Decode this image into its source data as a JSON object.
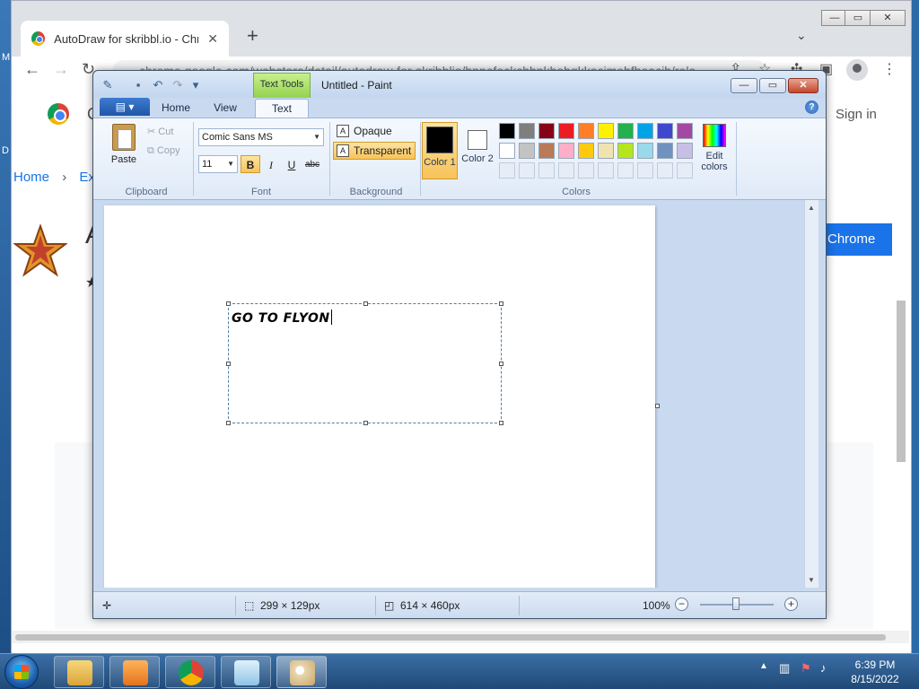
{
  "browser": {
    "tab_title": "AutoDraw for skribbl.io - Chrome Web Store",
    "url": "chrome.google.com/webstore/detail/autodraw-for-skribblio/bnpefeckchbnkbabgkkacimehfheacib/rela...",
    "signin_label": "Sign in",
    "breadcrumb_home": "Home",
    "breadcrumb_sep": "›",
    "breadcrumb_next": "Ext",
    "add_button_label": "Chrome",
    "letter_a": "A",
    "letter_c": "C",
    "star_glyph": "★",
    "new_tab_glyph": "+",
    "chevron_glyph": "⌄",
    "close_glyph": "✕"
  },
  "desktop": {
    "edge_letter_m": "M",
    "edge_letter_d": "D"
  },
  "paint": {
    "window_title": "Untitled - Paint",
    "context_tab": "Text Tools",
    "tabs": [
      "Home",
      "View",
      "Text"
    ],
    "active_tab": "Text",
    "clipboard": {
      "paste": "Paste",
      "cut": "Cut",
      "copy": "Copy",
      "label": "Clipboard"
    },
    "font": {
      "name": "Comic Sans MS",
      "size": "11",
      "bold": "B",
      "italic": "I",
      "underline": "U",
      "strike": "abc",
      "label": "Font"
    },
    "background": {
      "opaque": "Opaque",
      "transparent": "Transparent",
      "label": "Background"
    },
    "colors": {
      "color1_label": "Color 1",
      "color2_label": "Color 2",
      "edit_label": "Edit colors",
      "label": "Colors",
      "color1": "#000000",
      "color2": "#ffffff",
      "palette_row1": [
        "#000000",
        "#7f7f7f",
        "#880015",
        "#ed1c24",
        "#ff7f27",
        "#fff200",
        "#22b14c",
        "#00a2e8",
        "#3f48cc",
        "#a349a4"
      ],
      "palette_row2": [
        "#ffffff",
        "#c3c3c3",
        "#b97a57",
        "#ffaec9",
        "#ffc90e",
        "#efe4b0",
        "#b5e61d",
        "#99d9ea",
        "#7092be",
        "#c8bfe7"
      ]
    },
    "canvas_text": "GO TO FLYON",
    "status": {
      "selection_size": "299 × 129px",
      "canvas_size": "614 × 460px",
      "zoom": "100%"
    }
  },
  "taskbar": {
    "time": "6:39 PM",
    "date": "8/15/2022",
    "apps": [
      "explorer",
      "media-player",
      "chrome",
      "notepad",
      "paint"
    ],
    "active_app": "paint"
  }
}
